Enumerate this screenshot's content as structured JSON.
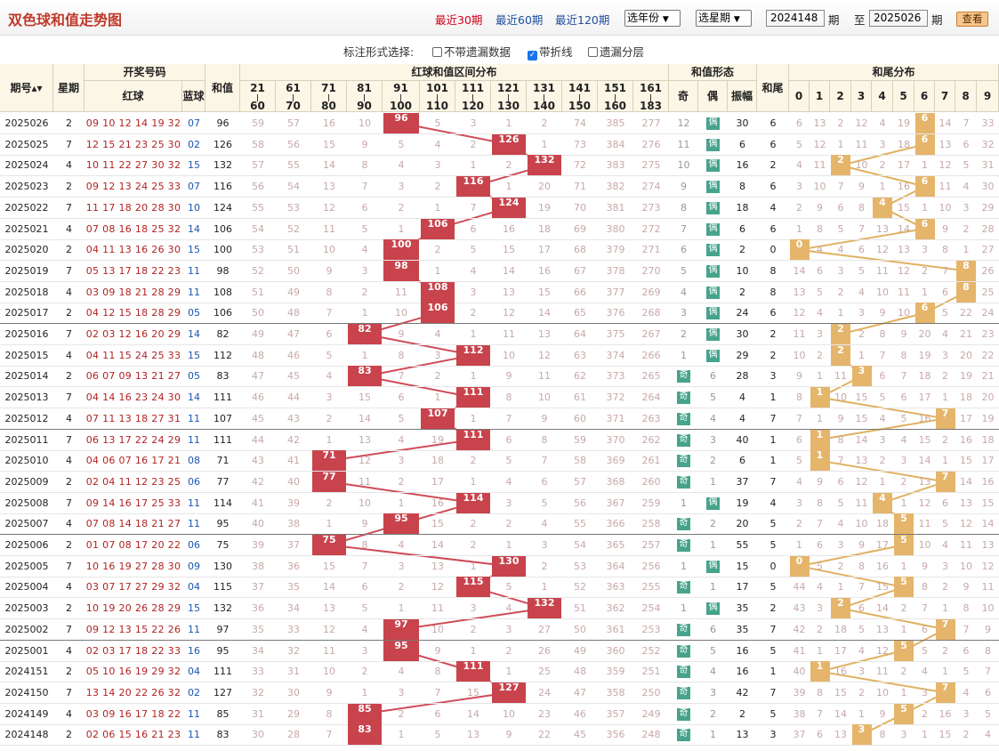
{
  "title": "双色球和值走势图",
  "nav": {
    "links": [
      "最近30期",
      "最近60期",
      "最近120期"
    ],
    "year": "选年份",
    "week": "选星期",
    "from": "2024148",
    "period": "期",
    "to_label": "至",
    "to": "2025026",
    "query": "查看"
  },
  "options": {
    "label": "标注形式选择:",
    "items": [
      {
        "label": "不带遗漏数据",
        "checked": false
      },
      {
        "label": "带折线",
        "checked": true
      },
      {
        "label": "遗漏分层",
        "checked": false
      }
    ]
  },
  "headers": {
    "issue": "期号",
    "week": "星期",
    "numbers": "开奖号码",
    "red": "红球",
    "blue": "蓝球",
    "sum": "和值",
    "dist": "红球和值区间分布",
    "ranges": [
      [
        "21",
        "60"
      ],
      [
        "61",
        "70"
      ],
      [
        "71",
        "80"
      ],
      [
        "81",
        "90"
      ],
      [
        "91",
        "100"
      ],
      [
        "101",
        "110"
      ],
      [
        "111",
        "120"
      ],
      [
        "121",
        "130"
      ],
      [
        "131",
        "140"
      ],
      [
        "141",
        "150"
      ],
      [
        "151",
        "160"
      ],
      [
        "161",
        "183"
      ]
    ],
    "form": "和值形态",
    "odd": "奇",
    "even": "偶",
    "amp": "振幅",
    "tail": "和尾",
    "taildist": "和尾分布",
    "digits": [
      "0",
      "1",
      "2",
      "3",
      "4",
      "5",
      "6",
      "7",
      "8",
      "9"
    ]
  },
  "rows": [
    {
      "p": "2025026",
      "w": "2",
      "r": "09 10 12 14 19 32",
      "b": "07",
      "s": "96",
      "z": "30",
      "t": "6",
      "rm": [
        "59",
        "57",
        "16",
        "10",
        "",
        "5",
        "3",
        "1",
        "2",
        "74",
        "385",
        "277"
      ],
      "om": [
        "12",
        ""
      ],
      "tm": [
        "6",
        "13",
        "2",
        "12",
        "4",
        "19",
        "",
        "14",
        "7",
        "33"
      ]
    },
    {
      "p": "2025025",
      "w": "7",
      "r": "12 15 21 23 25 30",
      "b": "02",
      "s": "126",
      "z": "6",
      "t": "6",
      "rm": [
        "58",
        "56",
        "15",
        "9",
        "5",
        "4",
        "2",
        "",
        "1",
        "73",
        "384",
        "276"
      ],
      "om": [
        "11",
        ""
      ],
      "tm": [
        "5",
        "12",
        "1",
        "11",
        "3",
        "18",
        "",
        "13",
        "6",
        "32"
      ]
    },
    {
      "p": "2025024",
      "w": "4",
      "r": "10 11 22 27 30 32",
      "b": "15",
      "s": "132",
      "z": "16",
      "t": "2",
      "rm": [
        "57",
        "55",
        "14",
        "8",
        "4",
        "3",
        "1",
        "2",
        "",
        "72",
        "383",
        "275"
      ],
      "om": [
        "10",
        ""
      ],
      "tm": [
        "4",
        "11",
        "",
        "10",
        "2",
        "17",
        "1",
        "12",
        "5",
        "31"
      ]
    },
    {
      "p": "2025023",
      "w": "2",
      "r": "09 12 13 24 25 33",
      "b": "07",
      "s": "116",
      "z": "8",
      "t": "6",
      "rm": [
        "56",
        "54",
        "13",
        "7",
        "3",
        "2",
        "",
        "1",
        "20",
        "71",
        "382",
        "274"
      ],
      "om": [
        "9",
        ""
      ],
      "tm": [
        "3",
        "10",
        "7",
        "9",
        "1",
        "16",
        "",
        "11",
        "4",
        "30"
      ]
    },
    {
      "p": "2025022",
      "w": "7",
      "r": "11 17 18 20 28 30",
      "b": "10",
      "s": "124",
      "z": "18",
      "t": "4",
      "rm": [
        "55",
        "53",
        "12",
        "6",
        "2",
        "1",
        "7",
        "",
        "19",
        "70",
        "381",
        "273"
      ],
      "om": [
        "8",
        ""
      ],
      "tm": [
        "2",
        "9",
        "6",
        "8",
        "",
        "15",
        "1",
        "10",
        "3",
        "29"
      ]
    },
    {
      "p": "2025021",
      "w": "4",
      "r": "07 08 16 18 25 32",
      "b": "14",
      "s": "106",
      "z": "6",
      "t": "6",
      "rm": [
        "54",
        "52",
        "11",
        "5",
        "1",
        "",
        "6",
        "16",
        "18",
        "69",
        "380",
        "272"
      ],
      "om": [
        "7",
        ""
      ],
      "tm": [
        "1",
        "8",
        "5",
        "7",
        "13",
        "14",
        "",
        "9",
        "2",
        "28"
      ]
    },
    {
      "p": "2025020",
      "w": "2",
      "r": "04 11 13 16 26 30",
      "b": "15",
      "s": "100",
      "z": "2",
      "t": "0",
      "rm": [
        "53",
        "51",
        "10",
        "4",
        "",
        "2",
        "5",
        "15",
        "17",
        "68",
        "379",
        "271"
      ],
      "om": [
        "6",
        ""
      ],
      "tm": [
        "",
        "4",
        "4",
        "6",
        "12",
        "13",
        "3",
        "8",
        "1",
        "27"
      ]
    },
    {
      "p": "2025019",
      "w": "7",
      "r": "05 13 17 18 22 23",
      "b": "11",
      "s": "98",
      "z": "10",
      "t": "8",
      "rm": [
        "52",
        "50",
        "9",
        "3",
        "",
        "1",
        "4",
        "14",
        "16",
        "67",
        "378",
        "270"
      ],
      "om": [
        "5",
        ""
      ],
      "tm": [
        "14",
        "6",
        "3",
        "5",
        "11",
        "12",
        "2",
        "7",
        "",
        "26"
      ]
    },
    {
      "p": "2025018",
      "w": "4",
      "r": "03 09 18 21 28 29",
      "b": "11",
      "s": "108",
      "z": "2",
      "t": "8",
      "rm": [
        "51",
        "49",
        "8",
        "2",
        "11",
        "",
        "3",
        "13",
        "15",
        "66",
        "377",
        "269"
      ],
      "om": [
        "4",
        ""
      ],
      "tm": [
        "13",
        "5",
        "2",
        "4",
        "10",
        "11",
        "1",
        "6",
        "",
        "25"
      ]
    },
    {
      "p": "2025017",
      "w": "2",
      "r": "04 12 15 18 28 29",
      "b": "05",
      "s": "106",
      "z": "24",
      "t": "6",
      "rm": [
        "50",
        "48",
        "7",
        "1",
        "10",
        "",
        "2",
        "12",
        "14",
        "65",
        "376",
        "268"
      ],
      "om": [
        "3",
        ""
      ],
      "tm": [
        "12",
        "4",
        "1",
        "3",
        "9",
        "10",
        "",
        "5",
        "22",
        "24"
      ],
      "sep": true
    },
    {
      "p": "2025016",
      "w": "7",
      "r": "02 03 12 16 20 29",
      "b": "14",
      "s": "82",
      "z": "30",
      "t": "2",
      "rm": [
        "49",
        "47",
        "6",
        "",
        "9",
        "4",
        "1",
        "11",
        "13",
        "64",
        "375",
        "267"
      ],
      "om": [
        "2",
        ""
      ],
      "tm": [
        "11",
        "3",
        "",
        "2",
        "8",
        "9",
        "20",
        "4",
        "21",
        "23"
      ]
    },
    {
      "p": "2025015",
      "w": "4",
      "r": "04 11 15 24 25 33",
      "b": "15",
      "s": "112",
      "z": "29",
      "t": "2",
      "rm": [
        "48",
        "46",
        "5",
        "1",
        "8",
        "3",
        "",
        "10",
        "12",
        "63",
        "374",
        "266"
      ],
      "om": [
        "1",
        ""
      ],
      "tm": [
        "10",
        "2",
        "",
        "1",
        "7",
        "8",
        "19",
        "3",
        "20",
        "22"
      ]
    },
    {
      "p": "2025014",
      "w": "2",
      "r": "06 07 09 13 21 27",
      "b": "05",
      "s": "83",
      "z": "28",
      "t": "3",
      "rm": [
        "47",
        "45",
        "4",
        "",
        "7",
        "2",
        "1",
        "9",
        "11",
        "62",
        "373",
        "265"
      ],
      "om": [
        "",
        "6"
      ],
      "tm": [
        "9",
        "1",
        "11",
        "",
        "6",
        "7",
        "18",
        "2",
        "19",
        "21"
      ]
    },
    {
      "p": "2025013",
      "w": "7",
      "r": "04 14 16 23 24 30",
      "b": "14",
      "s": "111",
      "z": "4",
      "t": "1",
      "rm": [
        "46",
        "44",
        "3",
        "15",
        "6",
        "1",
        "",
        "8",
        "10",
        "61",
        "372",
        "264"
      ],
      "om": [
        "",
        "5"
      ],
      "tm": [
        "8",
        "",
        "10",
        "15",
        "5",
        "6",
        "17",
        "1",
        "18",
        "20"
      ]
    },
    {
      "p": "2025012",
      "w": "4",
      "r": "07 11 13 18 27 31",
      "b": "11",
      "s": "107",
      "z": "4",
      "t": "7",
      "rm": [
        "45",
        "43",
        "2",
        "14",
        "5",
        "",
        "1",
        "7",
        "9",
        "60",
        "371",
        "263"
      ],
      "om": [
        "",
        "4"
      ],
      "tm": [
        "7",
        "1",
        "9",
        "15",
        "4",
        "5",
        "16",
        "",
        "17",
        "19"
      ],
      "sep": true
    },
    {
      "p": "2025011",
      "w": "7",
      "r": "06 13 17 22 24 29",
      "b": "11",
      "s": "111",
      "z": "40",
      "t": "1",
      "rm": [
        "44",
        "42",
        "1",
        "13",
        "4",
        "19",
        "",
        "6",
        "8",
        "59",
        "370",
        "262"
      ],
      "om": [
        "",
        "3"
      ],
      "tm": [
        "6",
        "",
        "8",
        "14",
        "3",
        "4",
        "15",
        "2",
        "16",
        "18"
      ]
    },
    {
      "p": "2025010",
      "w": "4",
      "r": "04 06 07 16 17 21",
      "b": "08",
      "s": "71",
      "z": "6",
      "t": "1",
      "rm": [
        "43",
        "41",
        "",
        "12",
        "3",
        "18",
        "2",
        "5",
        "7",
        "58",
        "369",
        "261"
      ],
      "om": [
        "",
        "2"
      ],
      "tm": [
        "5",
        "",
        "7",
        "13",
        "2",
        "3",
        "14",
        "1",
        "15",
        "17"
      ]
    },
    {
      "p": "2025009",
      "w": "2",
      "r": "02 04 11 12 23 25",
      "b": "06",
      "s": "77",
      "z": "37",
      "t": "7",
      "rm": [
        "42",
        "40",
        "",
        "11",
        "2",
        "17",
        "1",
        "4",
        "6",
        "57",
        "368",
        "260"
      ],
      "om": [
        "",
        "1"
      ],
      "tm": [
        "4",
        "9",
        "6",
        "12",
        "1",
        "2",
        "13",
        "",
        "14",
        "16"
      ]
    },
    {
      "p": "2025008",
      "w": "7",
      "r": "09 14 16 17 25 33",
      "b": "11",
      "s": "114",
      "z": "19",
      "t": "4",
      "rm": [
        "41",
        "39",
        "2",
        "10",
        "1",
        "16",
        "",
        "3",
        "5",
        "56",
        "367",
        "259"
      ],
      "om": [
        "1",
        ""
      ],
      "tm": [
        "3",
        "8",
        "5",
        "11",
        "",
        "1",
        "12",
        "6",
        "13",
        "15"
      ]
    },
    {
      "p": "2025007",
      "w": "4",
      "r": "07 08 14 18 21 27",
      "b": "11",
      "s": "95",
      "z": "20",
      "t": "5",
      "rm": [
        "40",
        "38",
        "1",
        "9",
        "",
        "15",
        "2",
        "2",
        "4",
        "55",
        "366",
        "258"
      ],
      "om": [
        "",
        "2"
      ],
      "tm": [
        "2",
        "7",
        "4",
        "10",
        "18",
        "",
        "11",
        "5",
        "12",
        "14"
      ],
      "sep": true
    },
    {
      "p": "2025006",
      "w": "2",
      "r": "01 07 08 17 20 22",
      "b": "06",
      "s": "75",
      "z": "55",
      "t": "5",
      "rm": [
        "39",
        "37",
        "",
        "8",
        "4",
        "14",
        "2",
        "1",
        "3",
        "54",
        "365",
        "257"
      ],
      "om": [
        "",
        "1"
      ],
      "tm": [
        "1",
        "6",
        "3",
        "9",
        "17",
        "",
        "10",
        "4",
        "11",
        "13"
      ]
    },
    {
      "p": "2025005",
      "w": "7",
      "r": "10 16 19 27 28 30",
      "b": "09",
      "s": "130",
      "z": "15",
      "t": "0",
      "rm": [
        "38",
        "36",
        "15",
        "7",
        "3",
        "13",
        "1",
        "",
        "2",
        "53",
        "364",
        "256"
      ],
      "om": [
        "1",
        ""
      ],
      "tm": [
        "",
        "5",
        "2",
        "8",
        "16",
        "1",
        "9",
        "3",
        "10",
        "12"
      ]
    },
    {
      "p": "2025004",
      "w": "4",
      "r": "03 07 17 27 29 32",
      "b": "04",
      "s": "115",
      "z": "17",
      "t": "5",
      "rm": [
        "37",
        "35",
        "14",
        "6",
        "2",
        "12",
        "",
        "5",
        "1",
        "52",
        "363",
        "255"
      ],
      "om": [
        "",
        "1"
      ],
      "tm": [
        "44",
        "4",
        "1",
        "7",
        "15",
        "",
        "8",
        "2",
        "9",
        "11"
      ]
    },
    {
      "p": "2025003",
      "w": "2",
      "r": "10 19 20 26 28 29",
      "b": "15",
      "s": "132",
      "z": "35",
      "t": "2",
      "rm": [
        "36",
        "34",
        "13",
        "5",
        "1",
        "11",
        "3",
        "4",
        "",
        "51",
        "362",
        "254"
      ],
      "om": [
        "1",
        ""
      ],
      "tm": [
        "43",
        "3",
        "",
        "6",
        "14",
        "2",
        "7",
        "1",
        "8",
        "10"
      ]
    },
    {
      "p": "2025002",
      "w": "7",
      "r": "09 12 13 15 22 26",
      "b": "11",
      "s": "97",
      "z": "35",
      "t": "7",
      "rm": [
        "35",
        "33",
        "12",
        "4",
        "",
        "10",
        "2",
        "3",
        "27",
        "50",
        "361",
        "253"
      ],
      "om": [
        "",
        "6"
      ],
      "tm": [
        "42",
        "2",
        "18",
        "5",
        "13",
        "1",
        "6",
        "",
        "7",
        "9"
      ],
      "sep": true
    },
    {
      "p": "2025001",
      "w": "4",
      "r": "02 03 17 18 22 33",
      "b": "16",
      "s": "95",
      "z": "16",
      "t": "5",
      "rm": [
        "34",
        "32",
        "11",
        "3",
        "",
        "9",
        "1",
        "2",
        "26",
        "49",
        "360",
        "252"
      ],
      "om": [
        "",
        "5"
      ],
      "tm": [
        "41",
        "1",
        "17",
        "4",
        "12",
        "",
        "5",
        "2",
        "6",
        "8"
      ]
    },
    {
      "p": "2024151",
      "w": "2",
      "r": "05 10 16 19 29 32",
      "b": "04",
      "s": "111",
      "z": "16",
      "t": "1",
      "rm": [
        "33",
        "31",
        "10",
        "2",
        "4",
        "8",
        "",
        "1",
        "25",
        "48",
        "359",
        "251"
      ],
      "om": [
        "",
        "4"
      ],
      "tm": [
        "40",
        "",
        "16",
        "3",
        "11",
        "2",
        "4",
        "1",
        "5",
        "7"
      ]
    },
    {
      "p": "2024150",
      "w": "7",
      "r": "13 14 20 22 26 32",
      "b": "02",
      "s": "127",
      "z": "42",
      "t": "7",
      "rm": [
        "32",
        "30",
        "9",
        "1",
        "3",
        "7",
        "15",
        "",
        "24",
        "47",
        "358",
        "250"
      ],
      "om": [
        "",
        "3"
      ],
      "tm": [
        "39",
        "8",
        "15",
        "2",
        "10",
        "1",
        "3",
        "",
        "4",
        "6"
      ]
    },
    {
      "p": "2024149",
      "w": "4",
      "r": "03 09 16 17 18 22",
      "b": "11",
      "s": "85",
      "z": "2",
      "t": "5",
      "rm": [
        "31",
        "29",
        "8",
        "",
        "2",
        "6",
        "14",
        "10",
        "23",
        "46",
        "357",
        "249"
      ],
      "om": [
        "",
        "2"
      ],
      "tm": [
        "38",
        "7",
        "14",
        "1",
        "9",
        "",
        "2",
        "16",
        "3",
        "5"
      ]
    },
    {
      "p": "2024148",
      "w": "2",
      "r": "02 06 15 16 21 23",
      "b": "11",
      "s": "83",
      "z": "13",
      "t": "3",
      "rm": [
        "30",
        "28",
        "7",
        "",
        "1",
        "5",
        "13",
        "9",
        "22",
        "45",
        "356",
        "248"
      ],
      "om": [
        "",
        "1"
      ],
      "tm": [
        "37",
        "6",
        "13",
        "",
        "8",
        "3",
        "1",
        "15",
        "2",
        "4"
      ]
    }
  ]
}
